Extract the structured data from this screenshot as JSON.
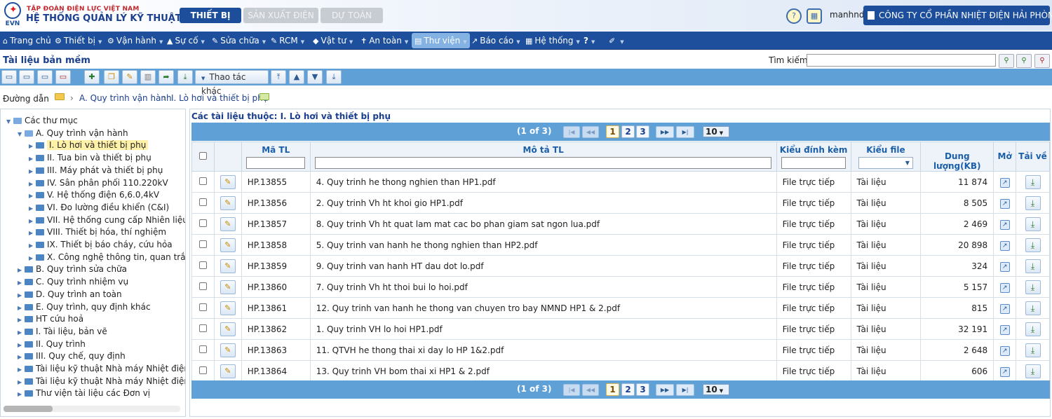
{
  "header": {
    "logo_text": "EVN",
    "company_small": "TẬP ĐOÀN ĐIỆN LỰC VIỆT NAM",
    "system_title": "HỆ THỐNG QUẢN LÝ KỸ THUẬT",
    "tabs": [
      {
        "label": "THIẾT BỊ",
        "active": true
      },
      {
        "label": "SẢN XUẤT ĐIỆN",
        "active": false
      },
      {
        "label": "DỰ TOÁN",
        "active": false
      }
    ],
    "username": "manhnd",
    "company": "CÔNG TY CỔ PHẦN NHIỆT ĐIỆN HẢI PHÒNG"
  },
  "menu": [
    {
      "label": "Trang chủ",
      "icon": "home-icon",
      "glyph": "⌂",
      "caret": false
    },
    {
      "label": "Thiết bị",
      "icon": "devices-icon",
      "glyph": "⚙",
      "caret": true
    },
    {
      "label": "Vận hành",
      "icon": "gears-icon",
      "glyph": "⚙",
      "caret": true
    },
    {
      "label": "Sự cố",
      "icon": "warning-icon",
      "glyph": "▲",
      "caret": true
    },
    {
      "label": "Sửa chữa",
      "icon": "wrench-icon",
      "glyph": "✎",
      "caret": true
    },
    {
      "label": "RCM",
      "icon": "wrench-icon",
      "glyph": "✎",
      "caret": true
    },
    {
      "label": "Vật tư",
      "icon": "box-icon",
      "glyph": "◆",
      "caret": true
    },
    {
      "label": "An toàn",
      "icon": "person-icon",
      "glyph": "✝",
      "caret": true
    },
    {
      "label": "Thư viện",
      "icon": "book-icon",
      "glyph": "▤",
      "caret": true,
      "active": true
    },
    {
      "label": "Báo cáo",
      "icon": "chart-icon",
      "glyph": "↗",
      "caret": true
    },
    {
      "label": "Hệ thống",
      "icon": "grid-icon",
      "glyph": "▦",
      "caret": true
    },
    {
      "label": "?",
      "icon": "",
      "glyph": "",
      "caret": true
    },
    {
      "label": "",
      "icon": "brush-icon",
      "glyph": "✐",
      "caret": true
    }
  ],
  "page": {
    "title": "Tài liệu bản mềm",
    "search_label": "Tìm kiếm",
    "search_value": "",
    "toolbar_dropdown": "Thao tác khác",
    "breadcrumb_label": "Đường dẫn",
    "breadcrumbs": [
      "A. Quy trình vận hành",
      "I. Lò hơi và thiết bị phụ"
    ]
  },
  "tree": [
    {
      "label": "Các thư mục",
      "level": 0,
      "open": true
    },
    {
      "label": "A. Quy trình vận hành",
      "level": 1,
      "open": true
    },
    {
      "label": "I. Lò hơi và thiết bị phụ",
      "level": 2,
      "selected": true
    },
    {
      "label": "II. Tua bin và thiết bị phụ",
      "level": 2
    },
    {
      "label": "III. Máy phát và thiết bị phụ",
      "level": 2
    },
    {
      "label": "IV. Sân phân phối 110.220kV",
      "level": 2
    },
    {
      "label": "V. Hệ thống điện 6,6.0,4kV",
      "level": 2
    },
    {
      "label": "VI. Đo lường điều khiển (C&I)",
      "level": 2
    },
    {
      "label": "VII. Hệ thống cung cấp Nhiên liệu",
      "level": 2
    },
    {
      "label": "VIII. Thiết bị hóa, thí nghiệm",
      "level": 2
    },
    {
      "label": "IX. Thiết bị báo cháy, cứu hỏa",
      "level": 2
    },
    {
      "label": "X. Công nghệ thông tin, quan trắc m",
      "level": 2
    },
    {
      "label": "B. Quy trình sửa chữa",
      "level": 1
    },
    {
      "label": "C. Quy trình nhiệm vụ",
      "level": 1
    },
    {
      "label": "D. Quy trình an toàn",
      "level": 1
    },
    {
      "label": "E. Quy trình, quy định khác",
      "level": 1
    },
    {
      "label": "HT cứu hoả",
      "level": 1
    },
    {
      "label": "I. Tài liệu, bản vẽ",
      "level": 1
    },
    {
      "label": "II. Quy trình",
      "level": 1
    },
    {
      "label": "III. Quy chế, quy định",
      "level": 1
    },
    {
      "label": "Tài liệu kỹ thuật Nhà máy Nhiệt điện Hả",
      "level": 1
    },
    {
      "label": "Tài liệu kỹ thuật Nhà máy Nhiệt điện Hả",
      "level": 1
    },
    {
      "label": "Thư viện tài liệu các Đơn vị",
      "level": 1
    }
  ],
  "grid": {
    "caption": "Các tài liệu thuộc: I. Lò hơi và thiết bị phụ",
    "pager": {
      "text": "(1 of 3)",
      "pages": [
        "1",
        "2",
        "3"
      ],
      "current": "1",
      "page_size": "10"
    },
    "columns": {
      "code": "Mã TL",
      "desc": "Mô tả TL",
      "attach": "Kiểu đính kèm",
      "filetype": "Kiểu file",
      "size": "Dung lượng(KB)",
      "open": "Mở",
      "download": "Tải về"
    },
    "rows": [
      {
        "code": "HP.13855",
        "desc": "4. Quy trinh he thong nghien than HP1.pdf",
        "attach": "File trực tiếp",
        "filetype": "Tài liệu",
        "size": "11 874"
      },
      {
        "code": "HP.13856",
        "desc": "2. Quy trinh Vh ht khoi gio HP1.pdf",
        "attach": "File trực tiếp",
        "filetype": "Tài liệu",
        "size": "8 505"
      },
      {
        "code": "HP.13857",
        "desc": "8. Quy trinh Vh ht quat lam mat cac bo phan giam sat ngon lua.pdf",
        "attach": "File trực tiếp",
        "filetype": "Tài liệu",
        "size": "2 469"
      },
      {
        "code": "HP.13858",
        "desc": "5. Quy trinh van hanh he thong nghien than HP2.pdf",
        "attach": "File trực tiếp",
        "filetype": "Tài liệu",
        "size": "20 898"
      },
      {
        "code": "HP.13859",
        "desc": "9. Quy trinh van hanh HT dau dot lo.pdf",
        "attach": "File trực tiếp",
        "filetype": "Tài liệu",
        "size": "324"
      },
      {
        "code": "HP.13860",
        "desc": "7. Quy trinh Vh ht thoi bui lo hoi.pdf",
        "attach": "File trực tiếp",
        "filetype": "Tài liệu",
        "size": "5 157"
      },
      {
        "code": "HP.13861",
        "desc": "12. Quy trinh van hanh he thong van chuyen tro bay NMND HP1 & 2.pdf",
        "attach": "File trực tiếp",
        "filetype": "Tài liệu",
        "size": "815"
      },
      {
        "code": "HP.13862",
        "desc": "1. Quy trinh VH lo hoi HP1.pdf",
        "attach": "File trực tiếp",
        "filetype": "Tài liệu",
        "size": "32 191"
      },
      {
        "code": "HP.13863",
        "desc": "11. QTVH he thong thai xi day lo HP 1&2.pdf",
        "attach": "File trực tiếp",
        "filetype": "Tài liệu",
        "size": "2 648"
      },
      {
        "code": "HP.13864",
        "desc": "13. Quy trinh VH bom thai xi HP1 & 2.pdf",
        "attach": "File trực tiếp",
        "filetype": "Tài liệu",
        "size": "606"
      }
    ]
  }
}
